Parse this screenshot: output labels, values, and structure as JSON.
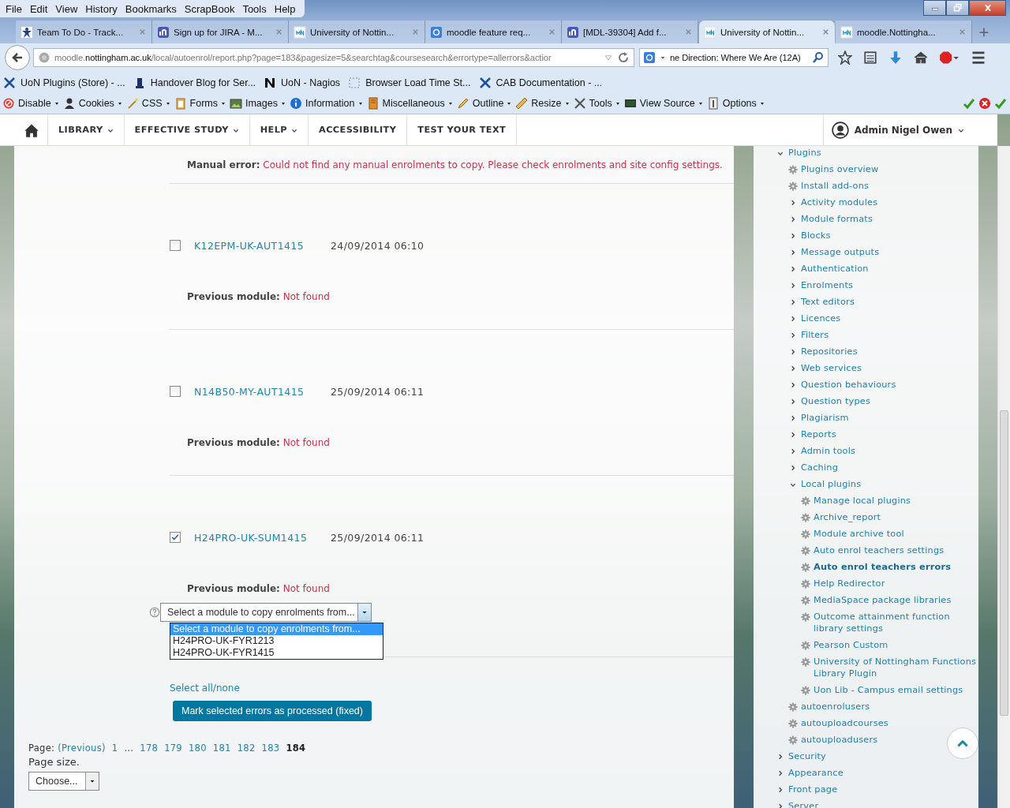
{
  "menu_bar": {
    "items": [
      "File",
      "Edit",
      "View",
      "History",
      "Bookmarks",
      "ScrapBook",
      "Tools",
      "Help"
    ]
  },
  "tabs": [
    {
      "title": "Team To Do - Track...",
      "kind": "people",
      "selected": false
    },
    {
      "title": "Sign up for JIRA - M...",
      "kind": "jira",
      "selected": false
    },
    {
      "title": "University of Nottin...",
      "kind": "moodle",
      "selected": false
    },
    {
      "title": "moodle feature req...",
      "kind": "google",
      "selected": false
    },
    {
      "title": "[MDL-39304] Add f...",
      "kind": "jira",
      "selected": false
    },
    {
      "title": "University of Nottin...",
      "kind": "moodle",
      "selected": true
    },
    {
      "title": "moodle.Nottingha...",
      "kind": "moodle",
      "selected": false
    }
  ],
  "navigation": {
    "url": {
      "host": "moodle.",
      "domain": "nottingham.ac.uk",
      "path": "/local/autoenrol/report.php?page=183&pagesize=5&searchtag&coursesearch&errortype=allerrors&actior"
    },
    "search": {
      "value": "ne Direction: Where We Are (12A)"
    }
  },
  "bookmarks": [
    {
      "label": "UoN Plugins (Store) - ...",
      "kind": "tools"
    },
    {
      "label": "Handover Blog for Ser...",
      "kind": "tower"
    },
    {
      "label": "UoN - Nagios",
      "kind": "nagios"
    },
    {
      "label": "Browser Load Time St...",
      "kind": "dotted"
    },
    {
      "label": "CAB Documentation - ...",
      "kind": "tools"
    }
  ],
  "dev_toolbar": [
    {
      "label": "Disable",
      "kind": "disable"
    },
    {
      "label": "Cookies",
      "kind": "cookies"
    },
    {
      "label": "CSS",
      "kind": "css"
    },
    {
      "label": "Forms",
      "kind": "forms"
    },
    {
      "label": "Images",
      "kind": "images"
    },
    {
      "label": "Information",
      "kind": "information"
    },
    {
      "label": "Miscellaneous",
      "kind": "misc"
    },
    {
      "label": "Outline",
      "kind": "outline"
    },
    {
      "label": "Resize",
      "kind": "resize"
    },
    {
      "label": "Tools",
      "kind": "tools"
    },
    {
      "label": "View Source",
      "kind": "source"
    },
    {
      "label": "Options",
      "kind": "options"
    }
  ],
  "site_nav": {
    "items": [
      {
        "label": "LIBRARY",
        "has_menu": true
      },
      {
        "label": "EFFECTIVE STUDY",
        "has_menu": true
      },
      {
        "label": "HELP",
        "has_menu": true
      },
      {
        "label": "ACCESSIBILITY",
        "has_menu": false
      },
      {
        "label": "TEST YOUR TEXT",
        "has_menu": false
      }
    ],
    "user": "Admin Nigel Owen"
  },
  "report": {
    "manual_error": {
      "label": "Manual error:",
      "text": "Could not find any manual enrolments to copy. Please check enrolments and site config settings."
    },
    "entries": [
      {
        "checked": false,
        "code": "K12EPM-UK-AUT1415",
        "date": "24/09/2014 06:10",
        "previous_label": "Previous module:",
        "previous_value": "Not found"
      },
      {
        "checked": false,
        "code": "N14B50-MY-AUT1415",
        "date": "25/09/2014 06:11",
        "previous_label": "Previous module:",
        "previous_value": "Not found"
      },
      {
        "checked": true,
        "code": "H24PRO-UK-SUM1415",
        "date": "25/09/2014 06:11",
        "previous_label": "Previous module:",
        "previous_value": "Not found"
      }
    ],
    "module_select": {
      "value": "Select a module to copy enrolments from...",
      "options": [
        {
          "label": "Select a module to copy enrolments from...",
          "selected": true
        },
        {
          "label": "H24PRO-UK-FYR1213",
          "selected": false
        },
        {
          "label": "H24PRO-UK-FYR1415",
          "selected": false
        }
      ]
    },
    "select_all": "Select all/none",
    "mark_button": "Mark selected errors as processed (fixed)",
    "pagination": {
      "label": "Page:",
      "previous": "(Previous)",
      "pages": [
        {
          "label": "1",
          "kind": "page",
          "selected": false
        },
        {
          "label": "...",
          "kind": "gap"
        },
        {
          "label": "178",
          "kind": "page",
          "selected": false
        },
        {
          "label": "179",
          "kind": "page",
          "selected": false
        },
        {
          "label": "180",
          "kind": "page",
          "selected": false
        },
        {
          "label": "181",
          "kind": "page",
          "selected": false
        },
        {
          "label": "182",
          "kind": "page",
          "selected": false
        },
        {
          "label": "183",
          "kind": "page",
          "selected": false
        },
        {
          "label": "184",
          "kind": "page",
          "selected": true
        }
      ]
    },
    "page_size": {
      "label": "Page size.",
      "value": "Choose..."
    }
  },
  "admin_tree": [
    {
      "label": "Plugins",
      "kind": "branch",
      "expanded": true,
      "selected": false,
      "children": [
        {
          "label": "Plugins overview",
          "kind": "leaf",
          "selected": false
        },
        {
          "label": "Install add-ons",
          "kind": "leaf",
          "selected": false
        },
        {
          "label": "Activity modules",
          "kind": "branch",
          "expanded": false,
          "selected": false
        },
        {
          "label": "Module formats",
          "kind": "branch",
          "expanded": false,
          "selected": false
        },
        {
          "label": "Blocks",
          "kind": "branch",
          "expanded": false,
          "selected": false
        },
        {
          "label": "Message outputs",
          "kind": "branch",
          "expanded": false,
          "selected": false
        },
        {
          "label": "Authentication",
          "kind": "branch",
          "expanded": false,
          "selected": false
        },
        {
          "label": "Enrolments",
          "kind": "branch",
          "expanded": false,
          "selected": false
        },
        {
          "label": "Text editors",
          "kind": "branch",
          "expanded": false,
          "selected": false
        },
        {
          "label": "Licences",
          "kind": "branch",
          "expanded": false,
          "selected": false
        },
        {
          "label": "Filters",
          "kind": "branch",
          "expanded": false,
          "selected": false
        },
        {
          "label": "Repositories",
          "kind": "branch",
          "expanded": false,
          "selected": false
        },
        {
          "label": "Web services",
          "kind": "branch",
          "expanded": false,
          "selected": false
        },
        {
          "label": "Question behaviours",
          "kind": "branch",
          "expanded": false,
          "selected": false
        },
        {
          "label": "Question types",
          "kind": "branch",
          "expanded": false,
          "selected": false
        },
        {
          "label": "Plagiarism",
          "kind": "branch",
          "expanded": false,
          "selected": false
        },
        {
          "label": "Reports",
          "kind": "branch",
          "expanded": false,
          "selected": false
        },
        {
          "label": "Admin tools",
          "kind": "branch",
          "expanded": false,
          "selected": false
        },
        {
          "label": "Caching",
          "kind": "branch",
          "expanded": false,
          "selected": false
        },
        {
          "label": "Local plugins",
          "kind": "branch",
          "expanded": true,
          "selected": false,
          "children": [
            {
              "label": "Manage local plugins",
              "kind": "leaf",
              "selected": false
            },
            {
              "label": "Archive_report",
              "kind": "leaf",
              "selected": false
            },
            {
              "label": "Module archive tool",
              "kind": "leaf",
              "selected": false
            },
            {
              "label": "Auto enrol teachers settings",
              "kind": "leaf",
              "selected": false
            },
            {
              "label": "Auto enrol teachers errors",
              "kind": "leaf",
              "selected": true
            },
            {
              "label": "Help Redirector",
              "kind": "leaf",
              "selected": false
            },
            {
              "label": "MediaSpace package libraries",
              "kind": "leaf",
              "selected": false
            },
            {
              "label": "Outcome attainment function library settings",
              "kind": "leaf",
              "selected": false
            },
            {
              "label": "Pearson Custom",
              "kind": "leaf",
              "selected": false
            },
            {
              "label": "University of Nottingham Functions Library Plugin",
              "kind": "leaf",
              "selected": false
            },
            {
              "label": "Uon Lib - Campus email settings",
              "kind": "leaf",
              "selected": false
            }
          ]
        },
        {
          "label": "autoenrolusers",
          "kind": "leaf",
          "selected": false
        },
        {
          "label": "autouploadcourses",
          "kind": "leaf",
          "selected": false
        },
        {
          "label": "autouploadusers",
          "kind": "leaf",
          "selected": false
        }
      ]
    },
    {
      "label": "Security",
      "kind": "branch",
      "expanded": false,
      "selected": false
    },
    {
      "label": "Appearance",
      "kind": "branch",
      "expanded": false,
      "selected": false
    },
    {
      "label": "Front page",
      "kind": "branch",
      "expanded": false,
      "selected": false
    },
    {
      "label": "Server",
      "kind": "branch",
      "expanded": false,
      "selected": false
    }
  ]
}
